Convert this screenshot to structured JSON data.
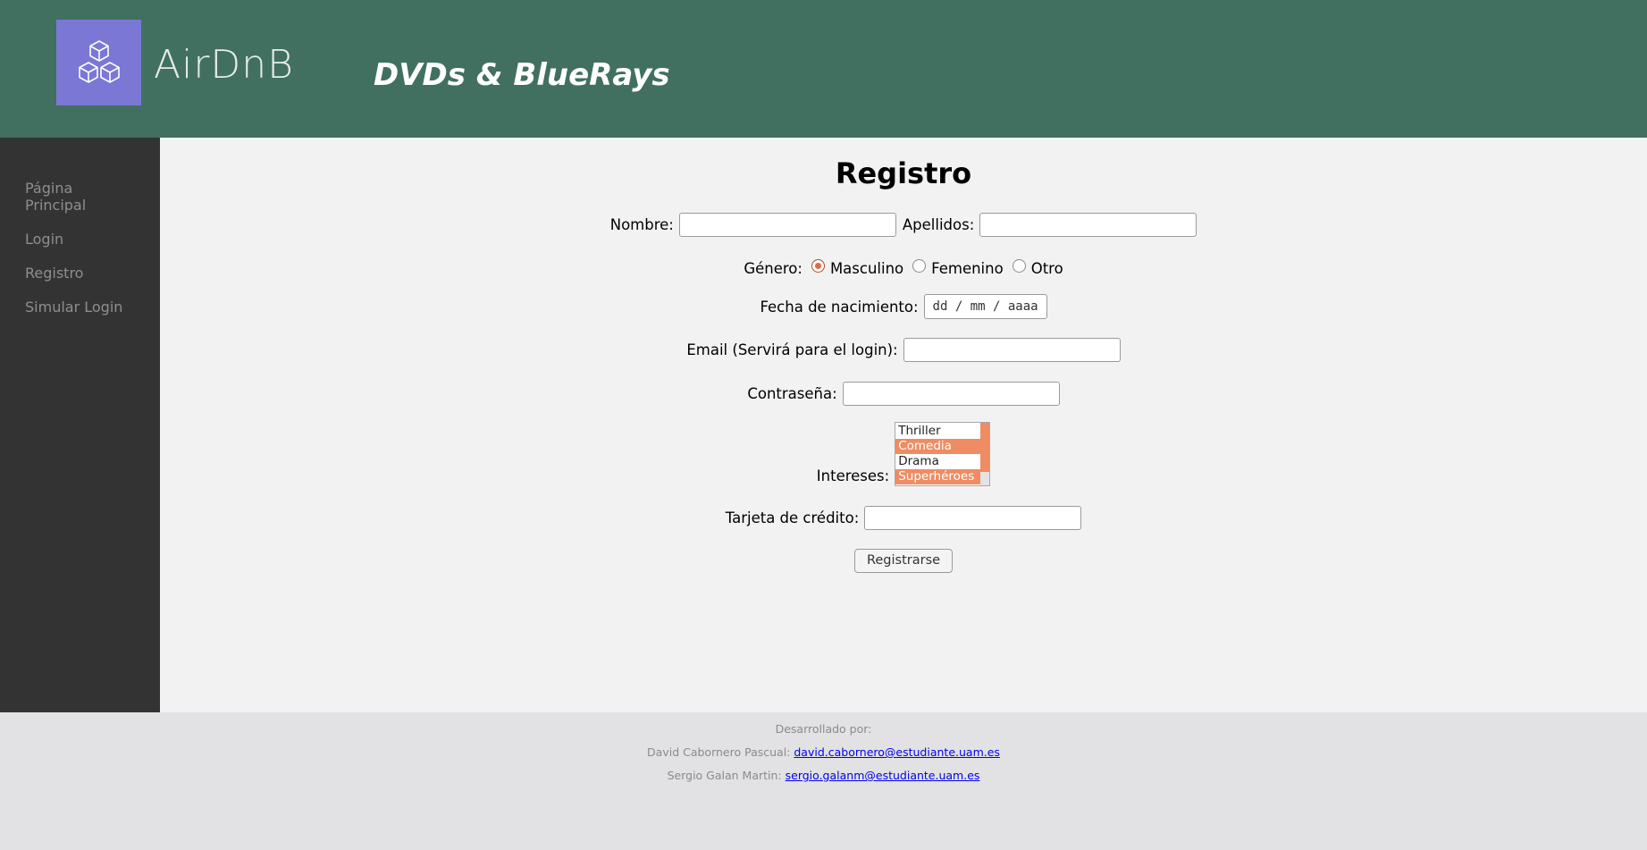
{
  "header": {
    "logo_text": "AirDnB",
    "site_title": "DVDs & BlueRays",
    "logo_icon": "cubes-icon"
  },
  "sidebar": {
    "items": [
      {
        "label_line1": "Página",
        "label_line2": "Principal"
      },
      {
        "label": "Login"
      },
      {
        "label": "Registro"
      },
      {
        "label": "Simular Login"
      }
    ]
  },
  "form": {
    "title": "Registro",
    "nombre_label": "Nombre:",
    "nombre_value": "",
    "apellidos_label": "Apellidos:",
    "apellidos_value": "",
    "genero_label": "Género:",
    "genero_options": [
      "Masculino",
      "Femenino",
      "Otro"
    ],
    "genero_selected": "Masculino",
    "fecha_label": "Fecha de nacimiento:",
    "fecha_placeholder": "dd / mm / aaaa",
    "email_label": "Email (Servirá para el login):",
    "email_value": "",
    "password_label": "Contraseña:",
    "password_value": "",
    "intereses_label": "Intereses:",
    "intereses_options": [
      {
        "label": "Thriller",
        "selected": false
      },
      {
        "label": "Comedia",
        "selected": true
      },
      {
        "label": "Drama",
        "selected": false
      },
      {
        "label": "Superhéroes",
        "selected": true
      }
    ],
    "tarjeta_label": "Tarjeta de crédito:",
    "tarjeta_value": "",
    "submit_label": "Registrarse"
  },
  "footer": {
    "dev_label": "Desarrollado por:",
    "dev1_name": "David Cabornero Pascual:",
    "dev1_email": "david.cabornero@estudiante.uam.es",
    "dev2_name": "Sergio Galan Martin:",
    "dev2_email": "sergio.galanm@estudiante.uam.es"
  },
  "colors": {
    "header_bg": "#417060",
    "sidebar_bg": "#333333",
    "main_bg": "#f2f2f2",
    "footer_bg": "#e2e2e4",
    "logo_bg": "#7a78d4",
    "accent": "#ef8c63"
  }
}
